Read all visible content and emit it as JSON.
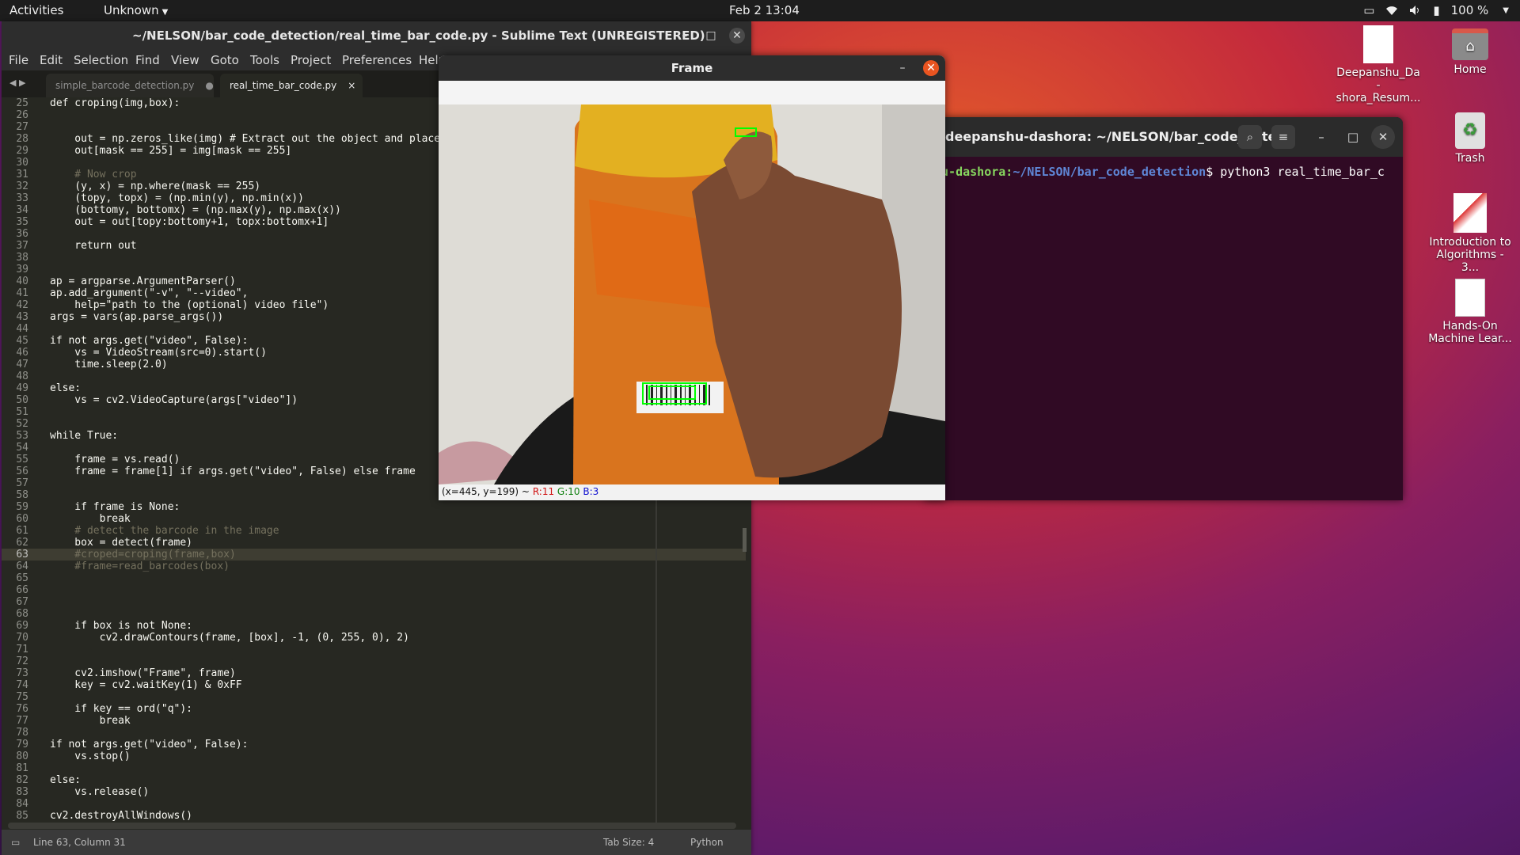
{
  "topbar": {
    "activities": "Activities",
    "app_menu": "Unknown",
    "clock": "Feb 2  13:04",
    "battery": "100 %"
  },
  "sublime": {
    "title": "~/NELSON/bar_code_detection/real_time_bar_code.py - Sublime Text (UNREGISTERED)",
    "menu": [
      "File",
      "Edit",
      "Selection",
      "Find",
      "View",
      "Goto",
      "Tools",
      "Project",
      "Preferences",
      "Help"
    ],
    "tabs": [
      {
        "label": "simple_barcode_detection.py",
        "mark": "●",
        "active": false
      },
      {
        "label": "real_time_bar_code.py",
        "mark": "×",
        "active": true
      }
    ],
    "current_line": 63,
    "code": [
      {
        "n": "25",
        "t": "def croping(img,box):"
      },
      {
        "n": "26",
        "t": ""
      },
      {
        "n": "27",
        "t": ""
      },
      {
        "n": "28",
        "t": "    out = np.zeros_like(img) # Extract out the object and place"
      },
      {
        "n": "29",
        "t": "    out[mask == 255] = img[mask == 255]"
      },
      {
        "n": "30",
        "t": ""
      },
      {
        "n": "31",
        "t": "    # Now crop"
      },
      {
        "n": "32",
        "t": "    (y, x) = np.where(mask == 255)"
      },
      {
        "n": "33",
        "t": "    (topy, topx) = (np.min(y), np.min(x))"
      },
      {
        "n": "34",
        "t": "    (bottomy, bottomx) = (np.max(y), np.max(x))"
      },
      {
        "n": "35",
        "t": "    out = out[topy:bottomy+1, topx:bottomx+1]"
      },
      {
        "n": "36",
        "t": ""
      },
      {
        "n": "37",
        "t": "    return out"
      },
      {
        "n": "38",
        "t": ""
      },
      {
        "n": "39",
        "t": ""
      },
      {
        "n": "40",
        "t": "ap = argparse.ArgumentParser()"
      },
      {
        "n": "41",
        "t": "ap.add_argument(\"-v\", \"--video\","
      },
      {
        "n": "42",
        "t": "    help=\"path to the (optional) video file\")"
      },
      {
        "n": "43",
        "t": "args = vars(ap.parse_args())"
      },
      {
        "n": "44",
        "t": ""
      },
      {
        "n": "45",
        "t": "if not args.get(\"video\", False):"
      },
      {
        "n": "46",
        "t": "    vs = VideoStream(src=0).start()"
      },
      {
        "n": "47",
        "t": "    time.sleep(2.0)"
      },
      {
        "n": "48",
        "t": ""
      },
      {
        "n": "49",
        "t": "else:"
      },
      {
        "n": "50",
        "t": "    vs = cv2.VideoCapture(args[\"video\"])"
      },
      {
        "n": "51",
        "t": ""
      },
      {
        "n": "52",
        "t": ""
      },
      {
        "n": "53",
        "t": "while True:"
      },
      {
        "n": "54",
        "t": ""
      },
      {
        "n": "55",
        "t": "    frame = vs.read()"
      },
      {
        "n": "56",
        "t": "    frame = frame[1] if args.get(\"video\", False) else frame"
      },
      {
        "n": "57",
        "t": ""
      },
      {
        "n": "58",
        "t": ""
      },
      {
        "n": "59",
        "t": "    if frame is None:"
      },
      {
        "n": "60",
        "t": "        break"
      },
      {
        "n": "61",
        "t": "    # detect the barcode in the image"
      },
      {
        "n": "62",
        "t": "    box = detect(frame)"
      },
      {
        "n": "63",
        "t": "    #croped=croping(frame,box)"
      },
      {
        "n": "64",
        "t": "    #frame=read_barcodes(box)"
      },
      {
        "n": "65",
        "t": ""
      },
      {
        "n": "66",
        "t": ""
      },
      {
        "n": "67",
        "t": ""
      },
      {
        "n": "68",
        "t": ""
      },
      {
        "n": "69",
        "t": "    if box is not None:"
      },
      {
        "n": "70",
        "t": "        cv2.drawContours(frame, [box], -1, (0, 255, 0), 2)"
      },
      {
        "n": "71",
        "t": ""
      },
      {
        "n": "72",
        "t": ""
      },
      {
        "n": "73",
        "t": "    cv2.imshow(\"Frame\", frame)"
      },
      {
        "n": "74",
        "t": "    key = cv2.waitKey(1) & 0xFF"
      },
      {
        "n": "75",
        "t": ""
      },
      {
        "n": "76",
        "t": "    if key == ord(\"q\"):"
      },
      {
        "n": "77",
        "t": "        break"
      },
      {
        "n": "78",
        "t": ""
      },
      {
        "n": "79",
        "t": "if not args.get(\"video\", False):"
      },
      {
        "n": "80",
        "t": "    vs.stop()"
      },
      {
        "n": "81",
        "t": ""
      },
      {
        "n": "82",
        "t": "else:"
      },
      {
        "n": "83",
        "t": "    vs.release()"
      },
      {
        "n": "84",
        "t": ""
      },
      {
        "n": "85",
        "t": "cv2.destroyAllWindows()"
      }
    ],
    "status": {
      "position": "Line 63, Column 31",
      "tab_size": "Tab Size: 4",
      "syntax": "Python"
    }
  },
  "terminal": {
    "title": "deepanshu-dashora: ~/NELSON/bar_code_dete...",
    "prompt_user": "hu-dashora:",
    "prompt_path": "~/NELSON/bar_code_detection",
    "prompt_symbol": "$ ",
    "command": "python3 real_time_bar_c"
  },
  "frame_window": {
    "title": "Frame",
    "pixel_info": {
      "coords": "(x=445, y=199) ~",
      "r": "R:11",
      "g": "G:10",
      "b": "B:3"
    }
  },
  "desktop": {
    "icons": [
      {
        "label": "Deepanshu_Da-shora_Resum..."
      },
      {
        "label": "Home"
      },
      {
        "label": "Trash"
      },
      {
        "label": "Introduction to Algorithms - 3..."
      },
      {
        "label": "Hands-On Machine Lear..."
      }
    ]
  },
  "colors": {
    "editor_bg": "#272822",
    "terminal_bg": "#300a24",
    "close_orange": "#e95420",
    "contour_green": "#00ff00"
  }
}
